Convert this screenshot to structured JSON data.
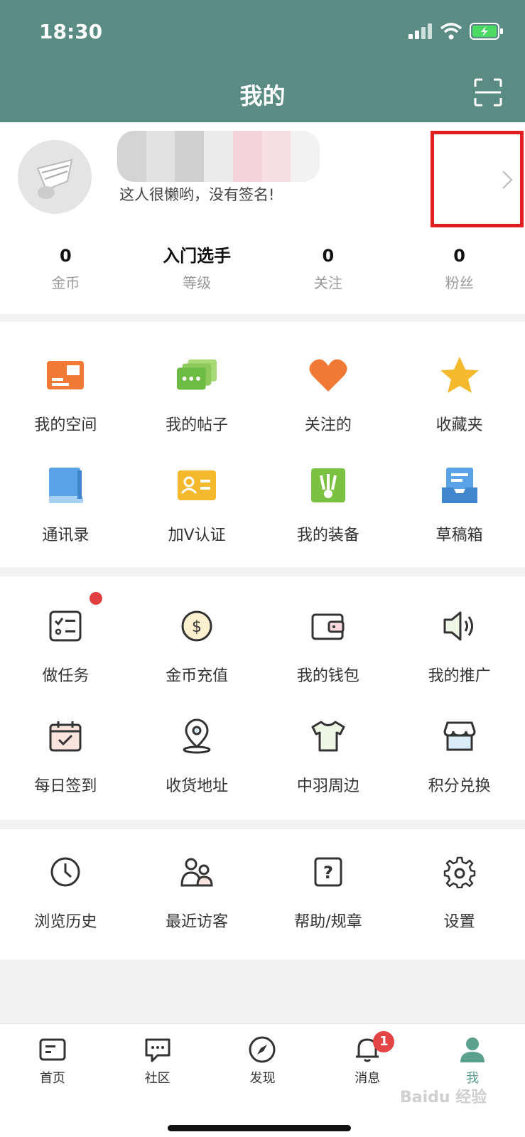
{
  "status": {
    "time": "18:30"
  },
  "header": {
    "title": "我的"
  },
  "profile": {
    "signature": "这人很懒哟，没有签名!",
    "stats": [
      {
        "value": "0",
        "label": "金币"
      },
      {
        "value": "入门选手",
        "label": "等级"
      },
      {
        "value": "0",
        "label": "关注"
      },
      {
        "value": "0",
        "label": "粉丝"
      }
    ]
  },
  "section1": [
    {
      "label": "我的空间",
      "icon": "id-card-icon"
    },
    {
      "label": "我的帖子",
      "icon": "posts-icon"
    },
    {
      "label": "关注的",
      "icon": "heart-icon"
    },
    {
      "label": "收藏夹",
      "icon": "star-icon"
    },
    {
      "label": "通讯录",
      "icon": "book-icon"
    },
    {
      "label": "加V认证",
      "icon": "verify-card-icon"
    },
    {
      "label": "我的装备",
      "icon": "shuttlecock-icon"
    },
    {
      "label": "草稿箱",
      "icon": "inbox-icon"
    }
  ],
  "section2": [
    {
      "label": "做任务",
      "icon": "task-list-icon"
    },
    {
      "label": "金币充值",
      "icon": "coin-icon"
    },
    {
      "label": "我的钱包",
      "icon": "wallet-icon"
    },
    {
      "label": "我的推广",
      "icon": "speaker-icon"
    },
    {
      "label": "每日签到",
      "icon": "calendar-check-icon"
    },
    {
      "label": "收货地址",
      "icon": "location-pin-icon"
    },
    {
      "label": "中羽周边",
      "icon": "tshirt-icon"
    },
    {
      "label": "积分兑换",
      "icon": "store-icon"
    }
  ],
  "section3": [
    {
      "label": "浏览历史",
      "icon": "clock-icon"
    },
    {
      "label": "最近访客",
      "icon": "visitors-icon"
    },
    {
      "label": "帮助/规章",
      "icon": "help-icon"
    },
    {
      "label": "设置",
      "icon": "gear-icon"
    }
  ],
  "nav": [
    {
      "label": "首页",
      "icon": "home-icon"
    },
    {
      "label": "社区",
      "icon": "chat-icon"
    },
    {
      "label": "发现",
      "icon": "compass-icon"
    },
    {
      "label": "消息",
      "icon": "bell-icon",
      "badge": "1"
    },
    {
      "label": "我",
      "icon": "user-icon",
      "active": true
    }
  ],
  "watermark": "Baidu 经验",
  "colors": {
    "header": "#5b8c84",
    "accent": "#5b9f8d",
    "badge": "#e34545"
  }
}
